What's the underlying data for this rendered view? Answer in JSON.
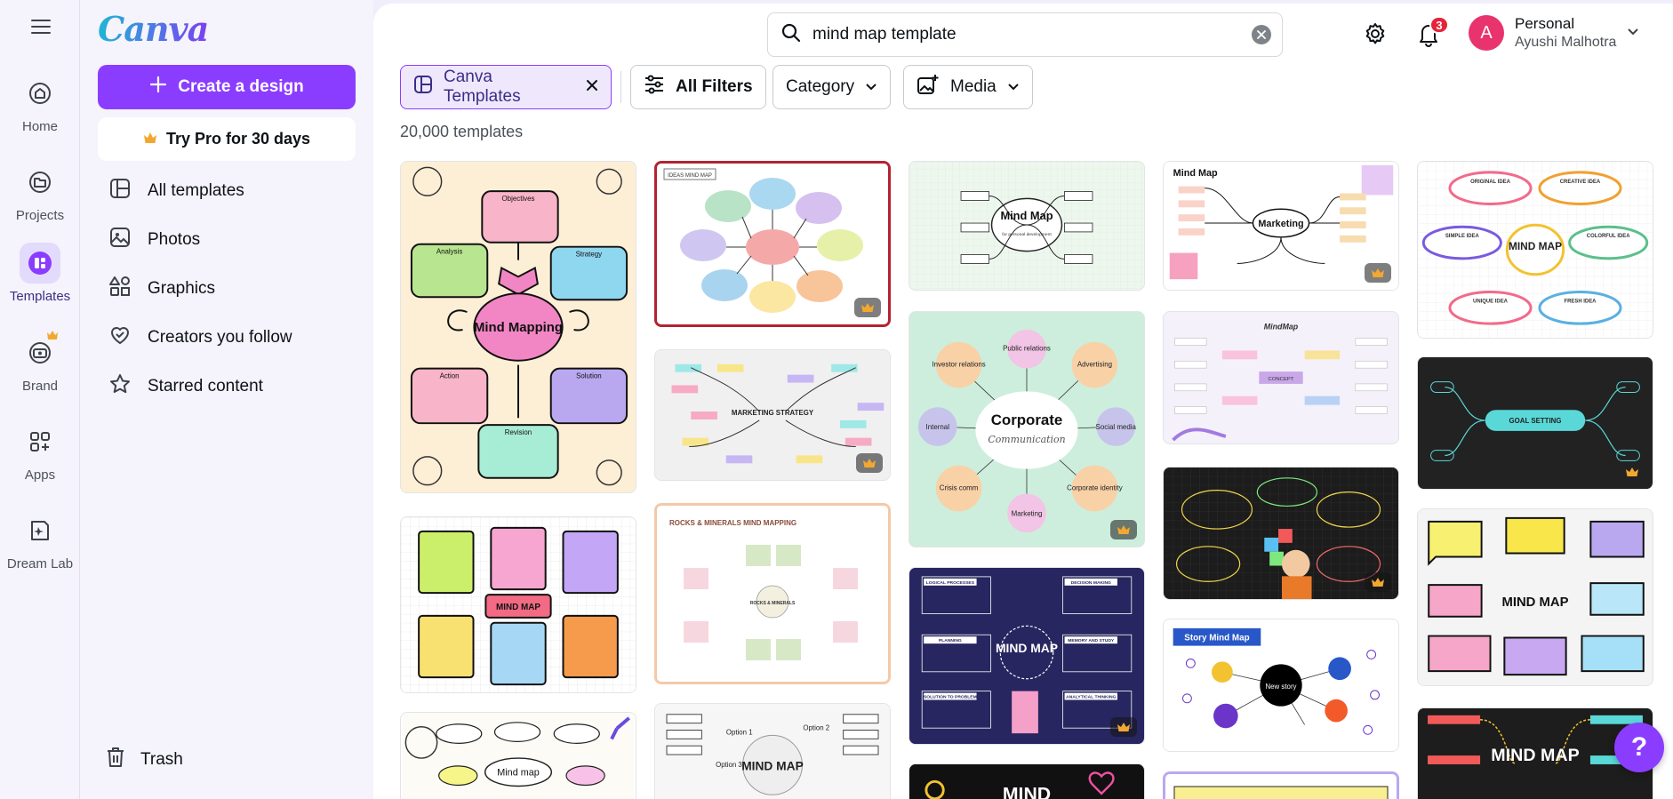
{
  "app": {
    "logo": "Canva"
  },
  "rail": {
    "items": [
      {
        "label": "Home",
        "icon": "home-icon"
      },
      {
        "label": "Projects",
        "icon": "folder-icon"
      },
      {
        "label": "Templates",
        "icon": "templates-icon",
        "active": true
      },
      {
        "label": "Brand",
        "icon": "brand-icon"
      },
      {
        "label": "Apps",
        "icon": "apps-icon"
      },
      {
        "label": "Dream Lab",
        "icon": "dream-lab-icon"
      }
    ]
  },
  "sidebar": {
    "create_label": "Create a design",
    "pro_label": "Try Pro for 30 days",
    "items": [
      {
        "label": "All templates",
        "icon": "all-templates-icon"
      },
      {
        "label": "Photos",
        "icon": "photos-icon"
      },
      {
        "label": "Graphics",
        "icon": "graphics-icon"
      },
      {
        "label": "Creators you follow",
        "icon": "heart-icon"
      },
      {
        "label": "Starred content",
        "icon": "star-icon"
      }
    ],
    "trash_label": "Trash"
  },
  "header": {
    "search_value": "mind map template",
    "notification_count": "3",
    "account": {
      "type": "Personal",
      "name": "Ayushi Malhotra",
      "initial": "A"
    }
  },
  "filters": {
    "active_chip": "Canva Templates",
    "all_filters": "All Filters",
    "category": "Category",
    "media": "Media"
  },
  "results": {
    "count_text": "20,000 templates"
  },
  "cards": {
    "c1": {
      "title": "Mind Mapping",
      "nodes": [
        "Objectives",
        "Analysis",
        "Strategy",
        "Action",
        "Solution",
        "Revision"
      ]
    },
    "c2": {
      "title": "IDEAS MIND MAP"
    },
    "c3": {
      "title": "Mind Map",
      "subtitle": "for personal development"
    },
    "c4": {
      "title": "Mind Map",
      "center": "Marketing"
    },
    "c5": {
      "center": "MIND MAP",
      "nodes": [
        "ORIGINAL IDEA",
        "CREATIVE IDEA",
        "SIMPLE IDEA",
        "COLORFUL IDEA",
        "UNIQUE IDEA",
        "FRESH IDEA"
      ]
    },
    "c6": {
      "center": "MARKETING STRATEGY"
    },
    "c7": {
      "center": "Corporate",
      "script": "Communication",
      "nodes": [
        "Public relations",
        "Investor relations",
        "Advertising",
        "Internal",
        "Social media",
        "Crisis comm",
        "Corporate identity",
        "Marketing"
      ]
    },
    "c8": {
      "title": "MindMap",
      "center": "CONCEPT"
    },
    "c9": {
      "title": "MIND MAP"
    },
    "c10": {
      "title": "ROCKS & MINERALS MIND MAPPING",
      "center": "ROCKS & MINERALS"
    },
    "c11": {
      "center": "MIND MAP",
      "nodes": [
        "LOGICAL PROCESSES",
        "DECISION MAKING",
        "PLANNING",
        "MEMORY AND STUDY",
        "SOLUTION TO PROBLEM",
        "ANALYTICAL THINKING"
      ]
    },
    "c12": {
      "center": "GOAL SETTING"
    },
    "c13": {
      "center": "MIND MAP"
    },
    "c14": {
      "title": "Story Mind Map",
      "center": "New story"
    },
    "c15": {
      "center": "MIND MAP"
    },
    "c16": {
      "center": "Mind map"
    },
    "c17": {
      "center": "MIND MAP",
      "nodes": [
        "Option 1",
        "Option 2",
        "Option 3"
      ]
    },
    "c18": {
      "center": "MIND"
    },
    "c19": {
      "center": "MIND MAP"
    }
  },
  "help": {
    "label": "?"
  },
  "colors": {
    "accent": "#8b3dff",
    "notification": "#e5243b",
    "avatar": "#e8336c"
  }
}
